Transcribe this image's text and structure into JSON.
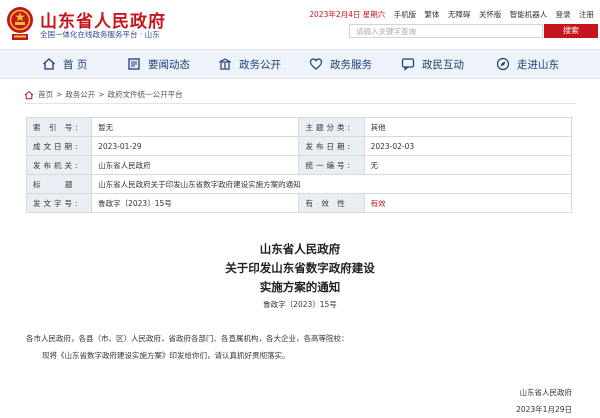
{
  "header": {
    "site_title": "山东省人民政府",
    "site_subtitle": "全国一体化在线政务服务平台 · 山东",
    "date": "2023年2月4日 星期六",
    "links": [
      "手机版",
      "繁体",
      "无障碍",
      "关怀版",
      "智能机器人",
      "登录",
      "注册"
    ],
    "search_placeholder": "请输入关键字查询",
    "search_button": "搜索",
    "brand_color": "#c4161c"
  },
  "nav": {
    "items": [
      {
        "label": "首 页",
        "icon": "home-icon"
      },
      {
        "label": "要闻动态",
        "icon": "news-icon"
      },
      {
        "label": "政务公开",
        "icon": "bank-icon"
      },
      {
        "label": "政务服务",
        "icon": "heart-icon"
      },
      {
        "label": "政民互动",
        "icon": "chat-icon"
      },
      {
        "label": "走进山东",
        "icon": "compass-icon"
      }
    ]
  },
  "breadcrumb": [
    "首页",
    "政务公开",
    "政府文件统一公开平台"
  ],
  "info": {
    "rows": [
      {
        "k1": "索 引 号:",
        "v1": "暂无",
        "k2": "主题分类:",
        "v2": "其他"
      },
      {
        "k1": "成文日期:",
        "v1": "2023-01-29",
        "k2": "发布日期:",
        "v2": "2023-02-03"
      },
      {
        "k1": "发布机关:",
        "v1": "山东省人民政府",
        "k2": "统一编号:",
        "v2": "无"
      }
    ],
    "title_label": "标    题",
    "title_value": "山东省人民政府关于印发山东省数字政府建设实施方案的通知",
    "docno_label": "发文字号:",
    "docno_value": "鲁政字〔2023〕15号",
    "validity_label": "有 效 性",
    "validity_value": "有效"
  },
  "document": {
    "title_lines": [
      "山东省人民政府",
      "关于印发山东省数字政府建设",
      "实施方案的通知"
    ],
    "doc_number": "鲁政字〔2023〕15号",
    "recipients": "各市人民政府，各县（市、区）人民政府，省政府各部门、各直属机构，各大企业，各高等院校：",
    "body": "现将《山东省数字政府建设实施方案》印发给你们，请认真抓好贯彻落实。",
    "signature": "山东省人民政府",
    "sign_date": "2023年1月29日"
  }
}
